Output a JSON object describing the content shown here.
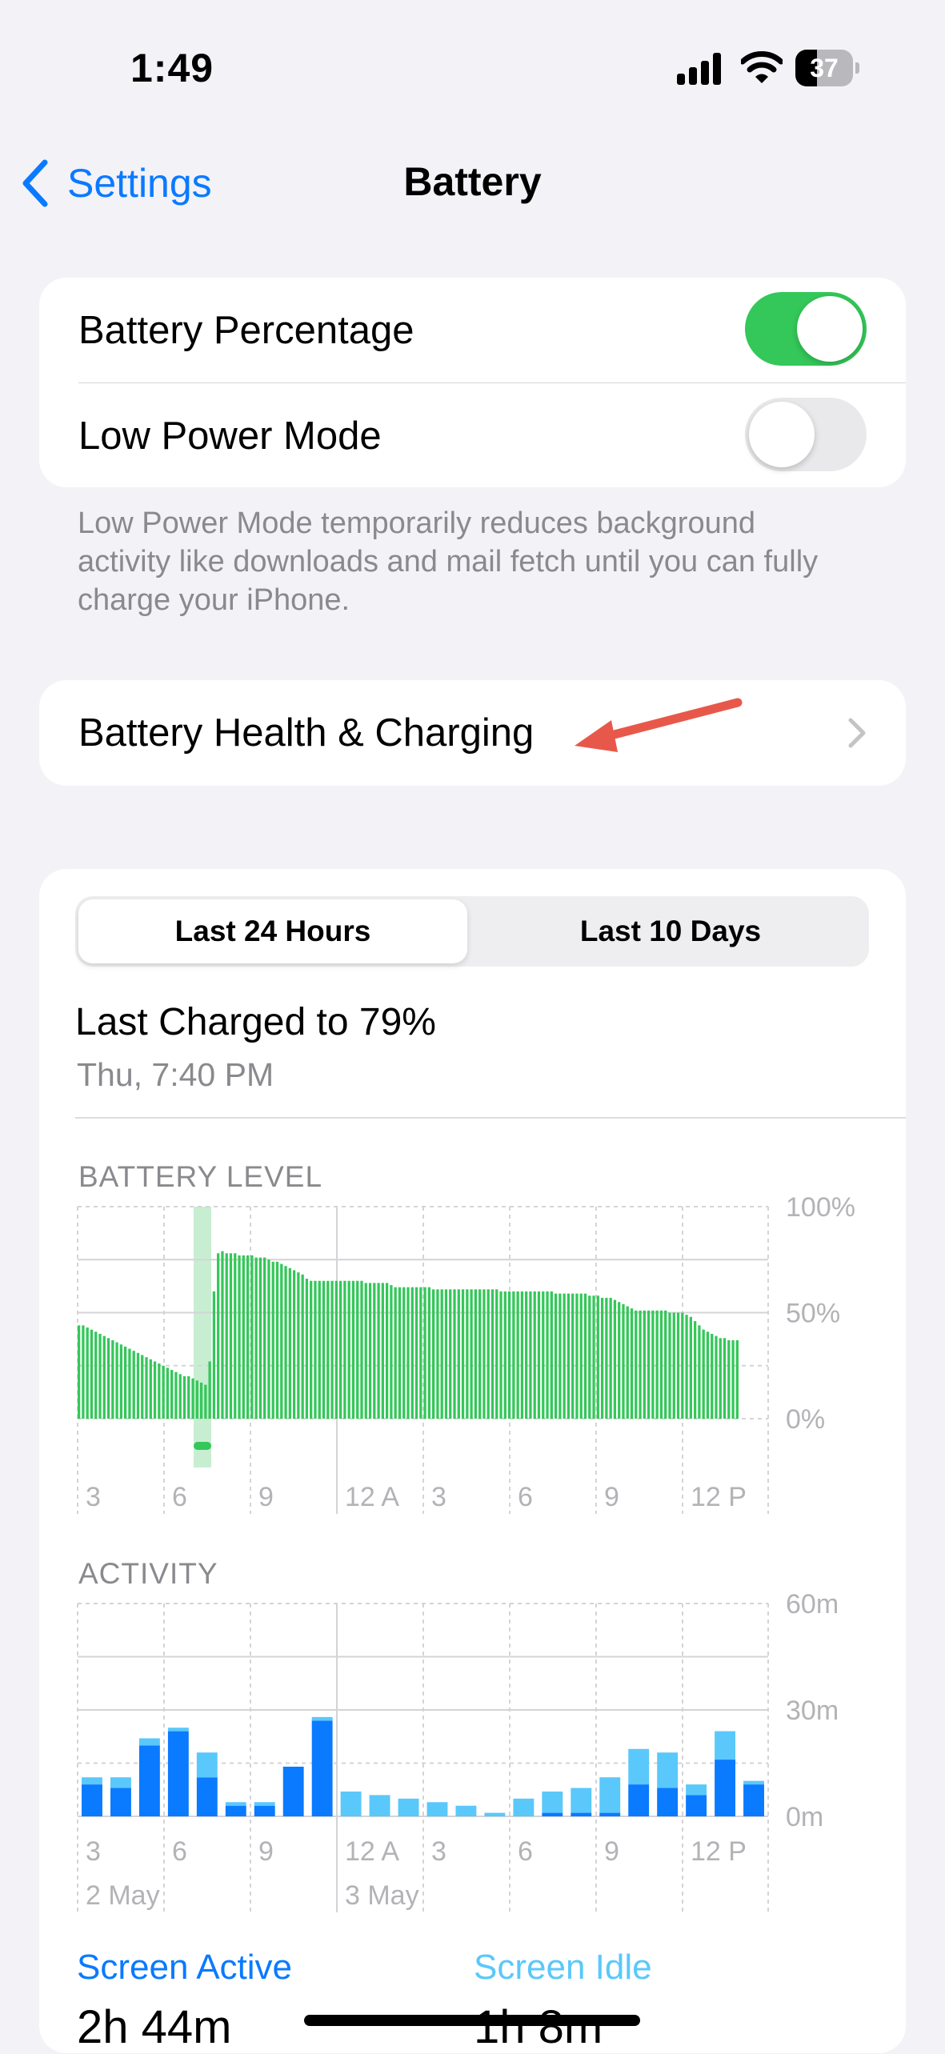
{
  "status_bar": {
    "time": "1:49",
    "battery_percent": "37",
    "battery_fraction": 0.37,
    "icons": [
      "cellular-signal-icon",
      "wifi-icon",
      "battery-icon"
    ]
  },
  "nav": {
    "back_label": "Settings",
    "title": "Battery"
  },
  "settings": {
    "battery_percentage": {
      "label": "Battery Percentage",
      "on": true
    },
    "low_power_mode": {
      "label": "Low Power Mode",
      "on": false
    },
    "footnote": "Low Power Mode temporarily reduces background activity like downloads and mail fetch until you can fully charge your iPhone."
  },
  "health_row": {
    "label": "Battery Health & Charging"
  },
  "usage": {
    "segments": [
      "Last 24 Hours",
      "Last 10 Days"
    ],
    "selected_segment": "Last 24 Hours",
    "last_charged": "Last Charged to 79%",
    "last_charged_time": "Thu, 7:40 PM",
    "battery_level_label": "BATTERY LEVEL",
    "activity_label": "ACTIVITY",
    "screen_active_label": "Screen Active",
    "screen_active_value": "2h 44m",
    "screen_idle_label": "Screen Idle",
    "screen_idle_value": "1h 8m"
  },
  "colors": {
    "accent": "#0a7aff",
    "green": "#34c759",
    "screen_active": "#0a7aff",
    "screen_idle": "#5ac8fa"
  },
  "chart_data": [
    {
      "type": "bar",
      "title": "BATTERY LEVEL",
      "x_tick_labels": [
        "3",
        "6",
        "9",
        "12 A",
        "3",
        "6",
        "9",
        "12 P"
      ],
      "y_tick_labels": [
        "100%",
        "50%",
        "0%"
      ],
      "ylim": [
        0,
        100
      ],
      "unit": "%",
      "charging_period": "around 7",
      "grid": true,
      "values": [
        44,
        44,
        43,
        42,
        41,
        40,
        39,
        38,
        37,
        36,
        35,
        34,
        33,
        32,
        31,
        30,
        29,
        28,
        27,
        26,
        25,
        24,
        23,
        22,
        21,
        20,
        20,
        19,
        18,
        17,
        16,
        27,
        60,
        78,
        79,
        78,
        78,
        78,
        77,
        77,
        77,
        77,
        76,
        76,
        76,
        75,
        74,
        74,
        73,
        72,
        71,
        70,
        69,
        68,
        66,
        65,
        65,
        65,
        65,
        65,
        65,
        65,
        65,
        65,
        65,
        65,
        65,
        65,
        64,
        64,
        64,
        64,
        64,
        64,
        63,
        62,
        62,
        62,
        62,
        62,
        62,
        62,
        62,
        62,
        61,
        61,
        61,
        61,
        61,
        61,
        61,
        61,
        61,
        61,
        61,
        61,
        61,
        61,
        61,
        61,
        60,
        60,
        60,
        60,
        60,
        60,
        60,
        60,
        60,
        60,
        60,
        60,
        60,
        59,
        59,
        59,
        59,
        59,
        59,
        59,
        59,
        58,
        58,
        58,
        57,
        57,
        57,
        56,
        55,
        54,
        53,
        52,
        51,
        51,
        51,
        51,
        51,
        51,
        51,
        51,
        50,
        50,
        50,
        50,
        49,
        48,
        46,
        44,
        42,
        41,
        40,
        39,
        38,
        38,
        37,
        37,
        37
      ]
    },
    {
      "type": "bar",
      "title": "ACTIVITY",
      "x_tick_labels": [
        "3",
        "6",
        "9",
        "12 A",
        "3",
        "6",
        "9",
        "12 P"
      ],
      "x_sublabels": [
        "2 May",
        "3 May"
      ],
      "y_tick_labels": [
        "60m",
        "30m",
        "0m"
      ],
      "ylim": [
        0,
        60
      ],
      "unit": "minutes",
      "series": [
        {
          "name": "Screen Active",
          "values": [
            9,
            8,
            20,
            24,
            11,
            3,
            3,
            14,
            27,
            0,
            0,
            0,
            0,
            0,
            0,
            0,
            1,
            1,
            1,
            9,
            8,
            6,
            16,
            9
          ]
        },
        {
          "name": "Screen Idle",
          "values": [
            2,
            3,
            2,
            1,
            7,
            1,
            1,
            0,
            1,
            7,
            6,
            5,
            4,
            3,
            1,
            5,
            6,
            7,
            10,
            10,
            10,
            3,
            8,
            1
          ]
        }
      ]
    }
  ]
}
